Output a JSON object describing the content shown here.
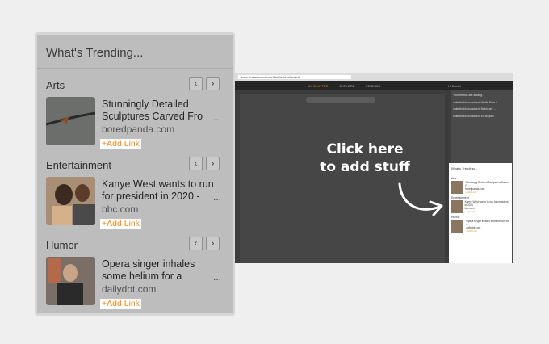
{
  "panel": {
    "title": "What's Trending...",
    "prev_icon": "chevron-left",
    "next_icon": "chevron-right",
    "sections": [
      {
        "heading": "Arts",
        "headline": "Stunningly Detailed Sculptures Carved Fro",
        "source": "boredpanda.com",
        "more": "...",
        "add_link": "+Add Link"
      },
      {
        "heading": "Entertainment",
        "headline": "Kanye West wants to run for president in 2020 -",
        "source": "bbc.com",
        "more": "...",
        "add_link": "+Add Link"
      },
      {
        "heading": "Humor",
        "headline": "Opera singer inhales some helium for a",
        "source": "dailydot.com",
        "more": "...",
        "add_link": "+Add Link"
      }
    ]
  },
  "screenshot": {
    "url": "www.clutterboard.com/itemlist/dashboard",
    "nav": [
      "MY CLUTTER",
      "EXPLORE",
      "FRIENDS"
    ],
    "user": "Hi Daniel",
    "friends_title": "Your friends are adding...",
    "friend_items": [
      "valentin.kirilov added: Wolf's Rain / ...",
      "valentin.kirilov added: Bablo are ...",
      "valentin.kirilov added: Il Europeo"
    ],
    "mini_title": "What's Trending...",
    "mini_sections": [
      {
        "heading": "Arts",
        "text": "Stunningly Detailed Sculptures Carved Fr...",
        "src": "boredpanda.com",
        "add": "+Add Link"
      },
      {
        "heading": "Entertainment",
        "text": "Kanye West wants to run for president in 2020",
        "src": "bbc.com",
        "add": "+Add Link"
      },
      {
        "heading": "Humor",
        "text": "Opera singer inhales some helium for a",
        "src": "dailydot.com",
        "add": "+Add Link"
      }
    ]
  },
  "callout": {
    "line1": "Click here",
    "line2": "to add stuff"
  }
}
